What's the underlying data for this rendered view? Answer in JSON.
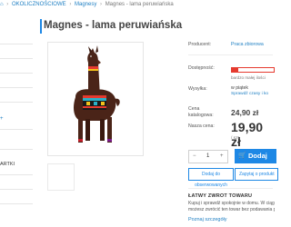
{
  "colors": {
    "accent": "#1e88e5",
    "link": "#1e7fc3",
    "availability": "#e53a2f"
  },
  "breadcrumb": {
    "items": [
      "OKOLICZNOŚCIOWE",
      "Magnesy",
      "Magnes - lama peruwiańska"
    ],
    "home_icon": "home-icon"
  },
  "page_title": "Magnes - lama peruwiańska",
  "sidebar": {
    "items": [
      "ARTKI"
    ],
    "more_link": "+"
  },
  "product": {
    "image_alt_icon": "llama-magnet-image",
    "producer_label": "Producent:",
    "producer_value": "Praca zbiorowa",
    "availability_label": "Dostępność:",
    "availability_level": 0.15,
    "availability_note": "bardzo małej ilości",
    "shipping_label": "Wysyłka:",
    "shipping_value": "w piątek",
    "shipping_link": "Sprawdź czasy i ko",
    "catalog_price_label_1": "Cena",
    "catalog_price_label_2": "katalogowa:",
    "catalog_price": "24,90 zł",
    "our_price_label": "Nasza cena:",
    "our_price": "19,90 zł",
    "unit": "/ szt.",
    "quantity": "1",
    "qty_minus": "−",
    "qty_plus": "+",
    "add_button": "Dodaj",
    "observe_button": "Dodaj do obserwowanych",
    "ask_button": "Zapytaj o produkt"
  },
  "returns": {
    "title": "ŁATWY ZWROT TOWARU",
    "line1": "Kupuj i sprawdź spokojnie w domu. W ciągu",
    "line2": "możesz zwrócić ten towar bez podawania przyczyny",
    "link": "Poznaj szczegóły"
  }
}
